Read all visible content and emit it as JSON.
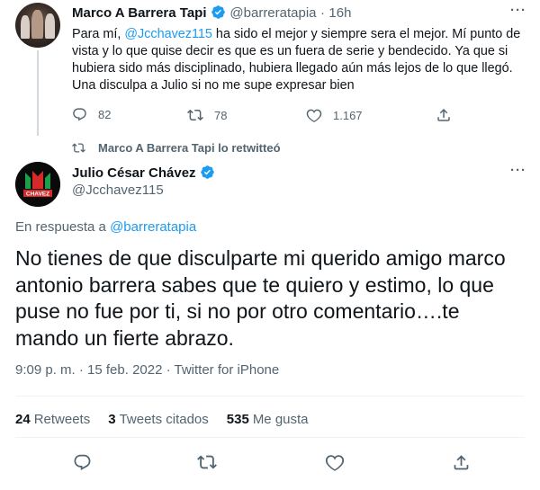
{
  "tweet1": {
    "author_name": "Marco A Barrera Tapi",
    "author_handle": "@barreratapia",
    "separator": "·",
    "time": "16h",
    "text_before": "Para mí, ",
    "mention": "@Jcchavez115",
    "text_after": " ha sido el mejor y siempre sera el mejor. Mí punto de vista y lo que quise decir es que es un fuera de serie y bendecido. Ya que si hubiera sido más disciplinado, hubiera llegado aún más lejos de lo que llegó. Una disculpa a Julio si no me supe expresar bien",
    "replies": "82",
    "retweets": "78",
    "likes": "1.167"
  },
  "retweet_banner": {
    "text": "Marco A Barrera Tapi lo retwitteó"
  },
  "tweet2": {
    "author_name": "Julio César Chávez",
    "author_handle": "@Jcchavez115",
    "avatar_text": "CHAVEZ",
    "reply_to_prefix": "En respuesta a ",
    "reply_to_handle": "@barreratapia",
    "text": "No tienes de que disculparte mi querido amigo marco antonio barrera sabes que te quiero y estimo, lo que puse no fue por ti, si no por otro comentario….te mando un fierte abrazo.",
    "timestamp": "9:09 p. m. · 15 feb. 2022 · Twitter for iPhone",
    "retweets_count": "24",
    "retweets_label": "Retweets",
    "quotes_count": "3",
    "quotes_label": "Tweets citados",
    "likes_count": "535",
    "likes_label": "Me gusta"
  },
  "colors": {
    "accent": "#1d9bf0",
    "text": "#0f1419",
    "muted": "#536471",
    "border": "#eff3f4"
  },
  "icons": [
    "verified-icon",
    "more-icon",
    "reply-icon",
    "retweet-icon",
    "like-icon",
    "share-icon"
  ]
}
